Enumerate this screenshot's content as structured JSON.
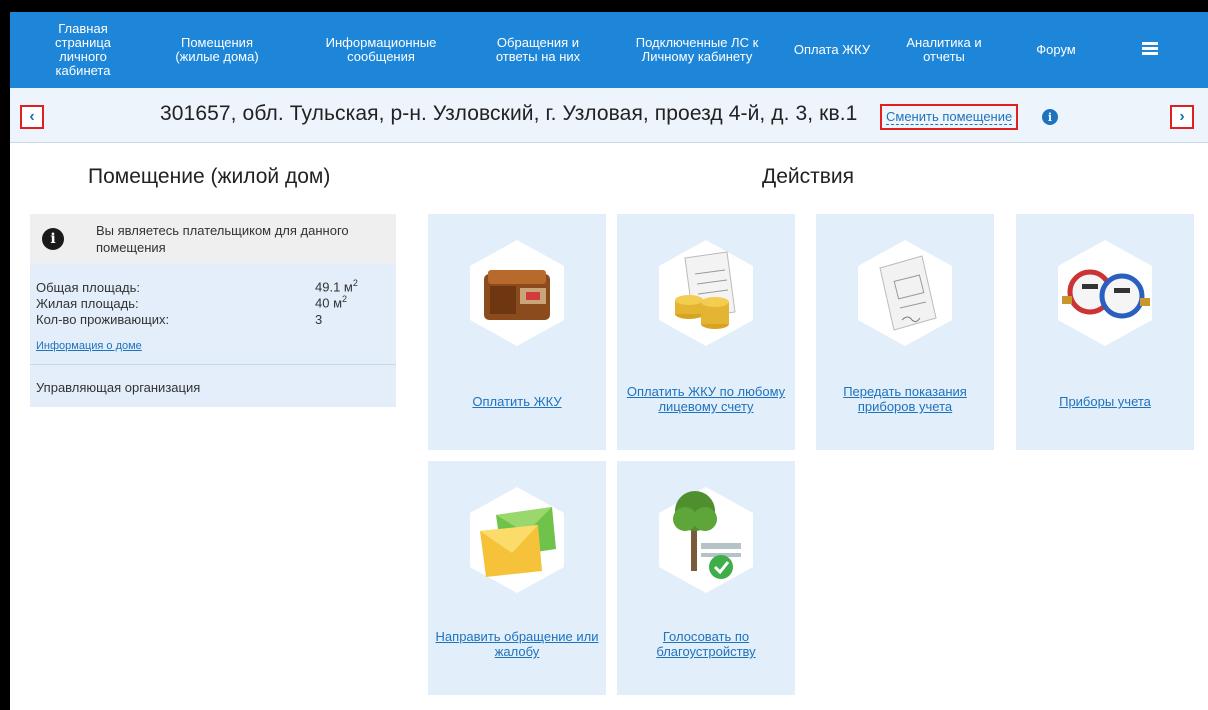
{
  "nav": {
    "items": [
      {
        "label_lines": [
          "Главная",
          "страница",
          "личного",
          "кабинета"
        ]
      },
      {
        "label_lines": [
          "Помещения",
          "(жилые дома)"
        ]
      },
      {
        "label_lines": [
          "Информационные",
          "сообщения"
        ]
      },
      {
        "label_lines": [
          "Обращения и",
          "ответы на них"
        ]
      },
      {
        "label_lines": [
          "Подключенные ЛС к",
          "Личному кабинету"
        ]
      },
      {
        "label_lines": [
          "Оплата ЖКУ"
        ]
      },
      {
        "label_lines": [
          "Аналитика и",
          "отчеты"
        ]
      },
      {
        "label_lines": [
          "Форум"
        ]
      }
    ],
    "menu_icon": "hamburger-menu-icon"
  },
  "address": {
    "text": "301657, обл. Тульская, р-н. Узловский, г. Узловая, проезд 4-й, д. 3, кв.1",
    "change_label": "Сменить помещение",
    "prev_icon": "chevron-left-icon",
    "next_icon": "chevron-right-icon",
    "info_icon": "info-icon"
  },
  "premise": {
    "title": "Помещение (жилой дом)",
    "payer_note": "Вы являетесь плательщиком для данного помещения",
    "rows": [
      {
        "label": "Общая площадь:",
        "value": "49.1 м",
        "sup": "2"
      },
      {
        "label": "Жилая площадь:",
        "value": "40 м",
        "sup": "2"
      },
      {
        "label": "Кол-во проживающих:",
        "value": "3",
        "sup": ""
      }
    ],
    "house_link": "Информация о доме",
    "org_label": "Управляющая организация"
  },
  "actions": {
    "title": "Действия",
    "tiles": [
      {
        "label": "Оплатить ЖКУ",
        "icon": "wallet-icon"
      },
      {
        "label": "Оплатить ЖКУ по любому лицевому счету",
        "icon": "receipt-coins-icon"
      },
      {
        "label": "Передать показания приборов учета",
        "icon": "meter-readings-form-icon"
      },
      {
        "label": "Приборы учета",
        "icon": "water-meters-icon"
      },
      {
        "label": "Направить обращение или жалобу",
        "icon": "envelopes-icon"
      },
      {
        "label": "Голосовать по благоустройству",
        "icon": "tree-bench-vote-icon"
      }
    ]
  },
  "colors": {
    "nav_bg": "#1e86d8",
    "tile_bg": "#e2eefa",
    "link": "#1e73be",
    "highlight_border": "#e02020"
  }
}
